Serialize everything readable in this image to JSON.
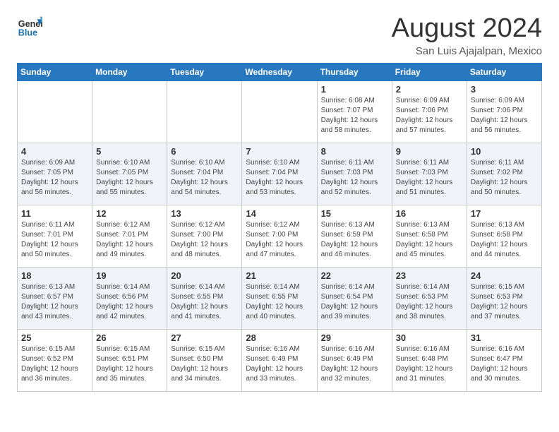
{
  "header": {
    "logo_line1": "General",
    "logo_line2": "Blue",
    "month_title": "August 2024",
    "location": "San Luis Ajajalpan, Mexico"
  },
  "weekdays": [
    "Sunday",
    "Monday",
    "Tuesday",
    "Wednesday",
    "Thursday",
    "Friday",
    "Saturday"
  ],
  "weeks": [
    [
      {
        "date": "",
        "info": ""
      },
      {
        "date": "",
        "info": ""
      },
      {
        "date": "",
        "info": ""
      },
      {
        "date": "",
        "info": ""
      },
      {
        "date": "1",
        "info": "Sunrise: 6:08 AM\nSunset: 7:07 PM\nDaylight: 12 hours\nand 58 minutes."
      },
      {
        "date": "2",
        "info": "Sunrise: 6:09 AM\nSunset: 7:06 PM\nDaylight: 12 hours\nand 57 minutes."
      },
      {
        "date": "3",
        "info": "Sunrise: 6:09 AM\nSunset: 7:06 PM\nDaylight: 12 hours\nand 56 minutes."
      }
    ],
    [
      {
        "date": "4",
        "info": "Sunrise: 6:09 AM\nSunset: 7:05 PM\nDaylight: 12 hours\nand 56 minutes."
      },
      {
        "date": "5",
        "info": "Sunrise: 6:10 AM\nSunset: 7:05 PM\nDaylight: 12 hours\nand 55 minutes."
      },
      {
        "date": "6",
        "info": "Sunrise: 6:10 AM\nSunset: 7:04 PM\nDaylight: 12 hours\nand 54 minutes."
      },
      {
        "date": "7",
        "info": "Sunrise: 6:10 AM\nSunset: 7:04 PM\nDaylight: 12 hours\nand 53 minutes."
      },
      {
        "date": "8",
        "info": "Sunrise: 6:11 AM\nSunset: 7:03 PM\nDaylight: 12 hours\nand 52 minutes."
      },
      {
        "date": "9",
        "info": "Sunrise: 6:11 AM\nSunset: 7:03 PM\nDaylight: 12 hours\nand 51 minutes."
      },
      {
        "date": "10",
        "info": "Sunrise: 6:11 AM\nSunset: 7:02 PM\nDaylight: 12 hours\nand 50 minutes."
      }
    ],
    [
      {
        "date": "11",
        "info": "Sunrise: 6:11 AM\nSunset: 7:01 PM\nDaylight: 12 hours\nand 50 minutes."
      },
      {
        "date": "12",
        "info": "Sunrise: 6:12 AM\nSunset: 7:01 PM\nDaylight: 12 hours\nand 49 minutes."
      },
      {
        "date": "13",
        "info": "Sunrise: 6:12 AM\nSunset: 7:00 PM\nDaylight: 12 hours\nand 48 minutes."
      },
      {
        "date": "14",
        "info": "Sunrise: 6:12 AM\nSunset: 7:00 PM\nDaylight: 12 hours\nand 47 minutes."
      },
      {
        "date": "15",
        "info": "Sunrise: 6:13 AM\nSunset: 6:59 PM\nDaylight: 12 hours\nand 46 minutes."
      },
      {
        "date": "16",
        "info": "Sunrise: 6:13 AM\nSunset: 6:58 PM\nDaylight: 12 hours\nand 45 minutes."
      },
      {
        "date": "17",
        "info": "Sunrise: 6:13 AM\nSunset: 6:58 PM\nDaylight: 12 hours\nand 44 minutes."
      }
    ],
    [
      {
        "date": "18",
        "info": "Sunrise: 6:13 AM\nSunset: 6:57 PM\nDaylight: 12 hours\nand 43 minutes."
      },
      {
        "date": "19",
        "info": "Sunrise: 6:14 AM\nSunset: 6:56 PM\nDaylight: 12 hours\nand 42 minutes."
      },
      {
        "date": "20",
        "info": "Sunrise: 6:14 AM\nSunset: 6:55 PM\nDaylight: 12 hours\nand 41 minutes."
      },
      {
        "date": "21",
        "info": "Sunrise: 6:14 AM\nSunset: 6:55 PM\nDaylight: 12 hours\nand 40 minutes."
      },
      {
        "date": "22",
        "info": "Sunrise: 6:14 AM\nSunset: 6:54 PM\nDaylight: 12 hours\nand 39 minutes."
      },
      {
        "date": "23",
        "info": "Sunrise: 6:14 AM\nSunset: 6:53 PM\nDaylight: 12 hours\nand 38 minutes."
      },
      {
        "date": "24",
        "info": "Sunrise: 6:15 AM\nSunset: 6:53 PM\nDaylight: 12 hours\nand 37 minutes."
      }
    ],
    [
      {
        "date": "25",
        "info": "Sunrise: 6:15 AM\nSunset: 6:52 PM\nDaylight: 12 hours\nand 36 minutes."
      },
      {
        "date": "26",
        "info": "Sunrise: 6:15 AM\nSunset: 6:51 PM\nDaylight: 12 hours\nand 35 minutes."
      },
      {
        "date": "27",
        "info": "Sunrise: 6:15 AM\nSunset: 6:50 PM\nDaylight: 12 hours\nand 34 minutes."
      },
      {
        "date": "28",
        "info": "Sunrise: 6:16 AM\nSunset: 6:49 PM\nDaylight: 12 hours\nand 33 minutes."
      },
      {
        "date": "29",
        "info": "Sunrise: 6:16 AM\nSunset: 6:49 PM\nDaylight: 12 hours\nand 32 minutes."
      },
      {
        "date": "30",
        "info": "Sunrise: 6:16 AM\nSunset: 6:48 PM\nDaylight: 12 hours\nand 31 minutes."
      },
      {
        "date": "31",
        "info": "Sunrise: 6:16 AM\nSunset: 6:47 PM\nDaylight: 12 hours\nand 30 minutes."
      }
    ]
  ]
}
